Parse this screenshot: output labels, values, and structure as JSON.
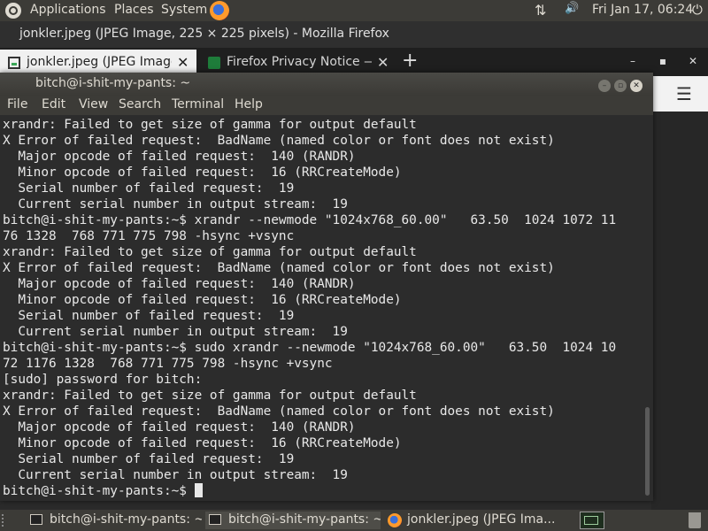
{
  "top_panel": {
    "applications": "Applications",
    "places": "Places",
    "system": "System",
    "network_glyph": "⇅",
    "volume_glyph": "🔊",
    "clock": "Fri Jan 17, 06:24",
    "power_glyph": "⏻"
  },
  "firefox": {
    "window_title": "jonkler.jpeg (JPEG Image, 225 × 225 pixels) - Mozilla Firefox",
    "tabs": [
      {
        "label": "jonkler.jpeg (JPEG Image"
      },
      {
        "label": "Firefox Privacy Notice —"
      }
    ],
    "tab_close": "✕",
    "new_tab": "+",
    "minimize": "–",
    "maximize": "▪",
    "close": "✕",
    "menu_glyph": "☰"
  },
  "terminal": {
    "title": "bitch@i-shit-my-pants: ~",
    "menu": [
      "File",
      "Edit",
      "View",
      "Search",
      "Terminal",
      "Help"
    ],
    "lines": [
      "xrandr: Failed to get size of gamma for output default",
      "X Error of failed request:  BadName (named color or font does not exist)",
      "  Major opcode of failed request:  140 (RANDR)",
      "  Minor opcode of failed request:  16 (RRCreateMode)",
      "  Serial number of failed request:  19",
      "  Current serial number in output stream:  19",
      "bitch@i-shit-my-pants:~$ xrandr --newmode \"1024x768_60.00\"   63.50  1024 1072 11",
      "76 1328  768 771 775 798 -hsync +vsync",
      "xrandr: Failed to get size of gamma for output default",
      "X Error of failed request:  BadName (named color or font does not exist)",
      "  Major opcode of failed request:  140 (RANDR)",
      "  Minor opcode of failed request:  16 (RRCreateMode)",
      "  Serial number of failed request:  19",
      "  Current serial number in output stream:  19",
      "bitch@i-shit-my-pants:~$ sudo xrandr --newmode \"1024x768_60.00\"   63.50  1024 10",
      "72 1176 1328  768 771 775 798 -hsync +vsync",
      "[sudo] password for bitch:",
      "xrandr: Failed to get size of gamma for output default",
      "X Error of failed request:  BadName (named color or font does not exist)",
      "  Major opcode of failed request:  140 (RANDR)",
      "  Minor opcode of failed request:  16 (RRCreateMode)",
      "  Serial number of failed request:  19",
      "  Current serial number in output stream:  19"
    ],
    "prompt": "bitch@i-shit-my-pants:~$ "
  },
  "taskbar": {
    "tasks": [
      {
        "label": "bitch@i-shit-my-pants: ~"
      },
      {
        "label": "bitch@i-shit-my-pants: ~"
      },
      {
        "label": "jonkler.jpeg (JPEG Ima..."
      }
    ]
  },
  "colors": {
    "panel": "#3c3b37",
    "terminal_bg": "#2c2c2c",
    "terminal_fg": "#e8e8e8"
  }
}
